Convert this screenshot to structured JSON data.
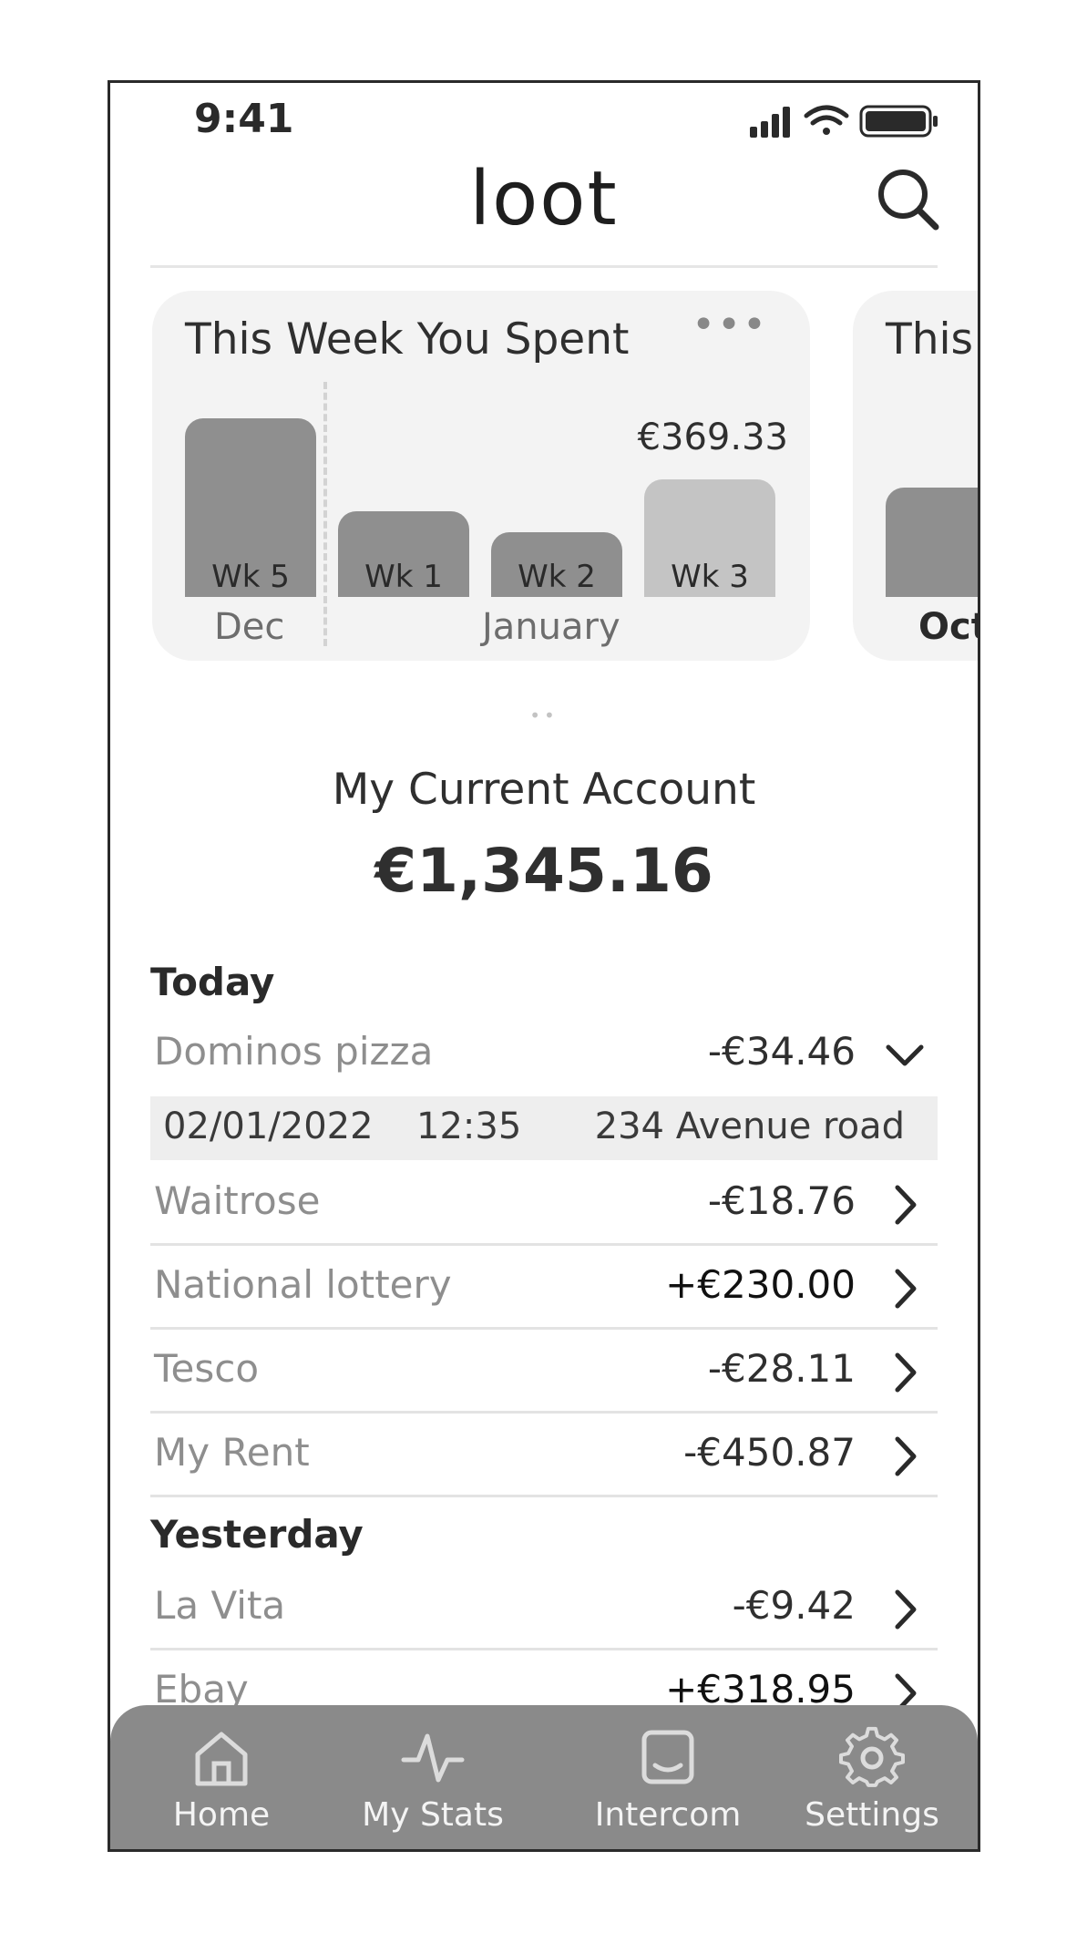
{
  "status_bar": {
    "time": "9:41"
  },
  "header": {
    "logo": "loot"
  },
  "spend_card": {
    "title": "This Week You Spent",
    "more": "•••",
    "highlight_value": "€369.33",
    "bars": [
      {
        "label": "Wk 5",
        "level": 1.0
      },
      {
        "label": "Wk 1",
        "level": 0.48
      },
      {
        "label": "Wk 2",
        "level": 0.36
      },
      {
        "label": "Wk 3",
        "level": 0.66
      }
    ],
    "months": [
      "Dec",
      "January"
    ]
  },
  "next_card": {
    "title": "This",
    "month": "Oct"
  },
  "pager": {
    "dots": "••"
  },
  "account": {
    "title": "My Current Account",
    "balance": "€1,345.16"
  },
  "sections": {
    "today": "Today",
    "yesterday": "Yesterday"
  },
  "transactions_today": [
    {
      "name": "Dominos pizza",
      "amount": "-€34.46"
    },
    {
      "name": "Waitrose",
      "amount": "-€18.76"
    },
    {
      "name": "National lottery",
      "amount": "+€230.00"
    },
    {
      "name": "Tesco",
      "amount": "-€28.11"
    },
    {
      "name": "My Rent",
      "amount": "-€450.87"
    }
  ],
  "expanded_detail": {
    "date": "02/01/2022",
    "time": "12:35",
    "location": "234 Avenue road"
  },
  "transactions_yesterday": [
    {
      "name": "La Vita",
      "amount": "-€9.42"
    },
    {
      "name": "Ebay",
      "amount": "+€318.95"
    }
  ],
  "tabbar": {
    "items": [
      {
        "label": "Home",
        "icon": "home-icon"
      },
      {
        "label": "My Stats",
        "icon": "pulse-icon"
      },
      {
        "label": "Intercom",
        "icon": "chat-icon"
      },
      {
        "label": "Settings",
        "icon": "gear-icon"
      }
    ]
  },
  "colors": {
    "bar": "#8f8f8f",
    "bar_highlight": "#c4c4c4",
    "tabbar": "#8a8a8a"
  }
}
